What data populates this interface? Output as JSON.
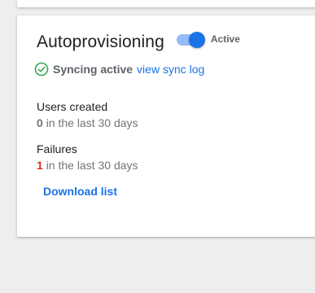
{
  "card": {
    "title": "Autoprovisioning",
    "toggle_state": "on",
    "toggle_label": "Active",
    "sync": {
      "icon": "check-circle-icon",
      "status_text": "Syncing active",
      "link_text": "view sync log",
      "status_color": "#34a853"
    },
    "users_created": {
      "label": "Users created",
      "count": "0",
      "period": "in the last 30 days"
    },
    "failures": {
      "label": "Failures",
      "count": "1",
      "period": "in the last 30 days",
      "count_color": "#d93025"
    },
    "download_label": "Download list"
  },
  "colors": {
    "accent": "#1a73e8",
    "background": "#eeeeee"
  }
}
